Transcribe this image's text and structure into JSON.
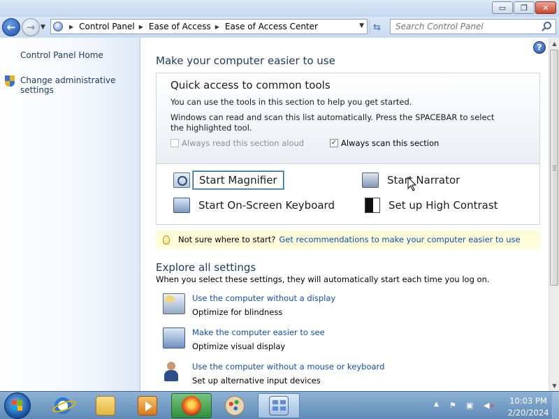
{
  "window": {
    "minimize_glyph": "▭",
    "maximize_glyph": "❐",
    "close_glyph": "✕"
  },
  "nav": {
    "back_glyph": "←",
    "forward_glyph": "→",
    "breadcrumbs": [
      "Control Panel",
      "Ease of Access",
      "Ease of Access Center"
    ],
    "refresh_glyph": "⇆",
    "search_placeholder": "Search Control Panel"
  },
  "sidebar": {
    "home_label": "Control Panel Home",
    "admin_label": "Change administrative settings"
  },
  "main": {
    "help_glyph": "?",
    "heading": "Make your computer easier to use",
    "quick": {
      "title": "Quick access to common tools",
      "line1": "You can use the tools in this section to help you get started.",
      "line2": "Windows can read and scan this list automatically.  Press the SPACEBAR to select the highlighted tool.",
      "read_aloud_label": "Always read this section aloud",
      "read_aloud_checked": false,
      "scan_label": "Always scan this section",
      "scan_checked": true,
      "check_glyph": "✓",
      "tools": {
        "magnifier": "Start Magnifier",
        "narrator": "Start Narrator",
        "keyboard": "Start On-Screen Keyboard",
        "contrast": "Set up High Contrast"
      }
    },
    "tip": {
      "text": "Not sure where to start?",
      "link": "Get recommendations to make your computer easier to use"
    },
    "explore": {
      "heading": "Explore all settings",
      "description": "When you select these settings, they will automatically start each time you log on.",
      "items": [
        {
          "link": "Use the computer without a display",
          "sub": "Optimize for blindness"
        },
        {
          "link": "Make the computer easier to see",
          "sub": "Optimize visual display"
        },
        {
          "link": "Use the computer without a mouse or keyboard",
          "sub": "Set up alternative input devices"
        }
      ]
    }
  },
  "taskbar": {
    "time": "10:03 PM",
    "date": "2/20/2024"
  },
  "colors": {
    "link": "#0c4fb0",
    "heading": "#1e3a64",
    "tip_bg": "#fefbd9",
    "taskbar": "#5f8ab8"
  }
}
